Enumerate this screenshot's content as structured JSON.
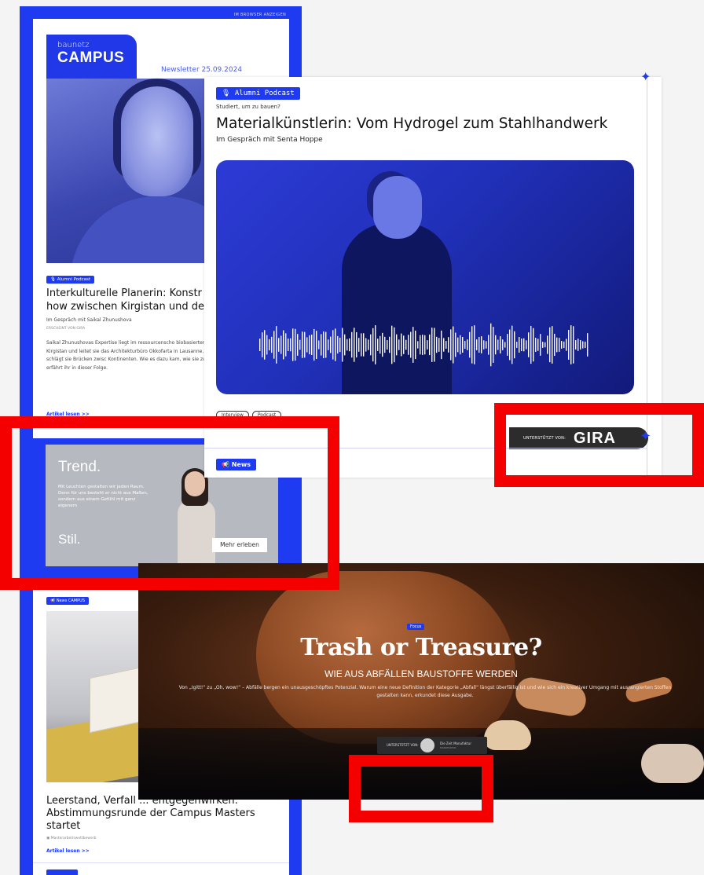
{
  "newsletter": {
    "top_link": "IM BROWSER ANZEIGEN",
    "logo_small": "baunetz",
    "logo_big": "CAMPUS",
    "date": "Newsletter 25.09.2024",
    "article1": {
      "badge": "Alumni Podcast",
      "title_line1": "Interkulturelle Planerin: Konstr",
      "title_line2": "how zwischen Kirgistan und de",
      "subtitle": "Im Gespräch mit Saikal Zhunushova",
      "author": "ERSCHEINT VON GIRA",
      "body": "Saikal Zhunushovas Expertise liegt im ressourcenscho biobasierten Materialien. Sie studierte in Kirgistan und leitet sie das Architekturbüro Okkofarta in Lausanne. I Praxis, Lehre und Forschung schlägt sie Brücken zwisc Kontinenten. Wie es dazu kam, wie sie zum Baustoff M Wissen weitergibt, erfährt ihr in dieser Folge.",
      "link": "Artikel lesen >>"
    },
    "article2": {
      "badge": "News CAMPUS",
      "title": "Leerstand, Verfall ... entgegenwirken: Abstimmungsrunde der Campus Masters startet",
      "tag": "Masterarbeitswettbewerb",
      "link": "Artikel lesen >>"
    }
  },
  "ad": {
    "headline": "Trend.",
    "copy": "Mit Leuchten gestalten wir jeden Raum. Denn für uns besteht er nicht aus Maßen, sondern aus einem Gefühl mit ganz eigenem",
    "tagline": "Stil.",
    "button": "Mehr erleben"
  },
  "podcast": {
    "badge": "Alumni Podcast",
    "kicker": "Studiert, um zu bauen?",
    "title": "Materialkünstlerin: Vom Hydrogel zum Stahlhandwerk",
    "subtitle": "Im Gespräch mit Senta Hoppe",
    "tags": [
      "Interview",
      "Podcast"
    ],
    "news_badge": "News",
    "sponsor_label": "UNTERSTÜTZT VON:",
    "sponsor_brand": "GIRA"
  },
  "hero": {
    "badge": "Focus",
    "title": "Trash or Treasure?",
    "subtitle": "WIE AUS ABFÄLLEN BAUSTOFFE WERDEN",
    "text": "Von „Igitt!“ zu „Oh, wow!“ – Abfälle bergen ein unausgeschöpftes Potenzial. Warum eine neue Definition der Kategorie „Abfall“ längst überfällig ist und wie sich ein kreativer Umgang mit ausrangierten Stoffen gestalten kann, erkundet diese Ausgabe.",
    "sponsor_label": "UNTERSTÜTZT VON:",
    "sponsor_brand": "Die Zeit Manufaktur",
    "sponsor_brand2": "MANUFAKTUR"
  },
  "colors": {
    "brand_blue": "#1f3bf2",
    "highlight_red": "#f40000"
  }
}
